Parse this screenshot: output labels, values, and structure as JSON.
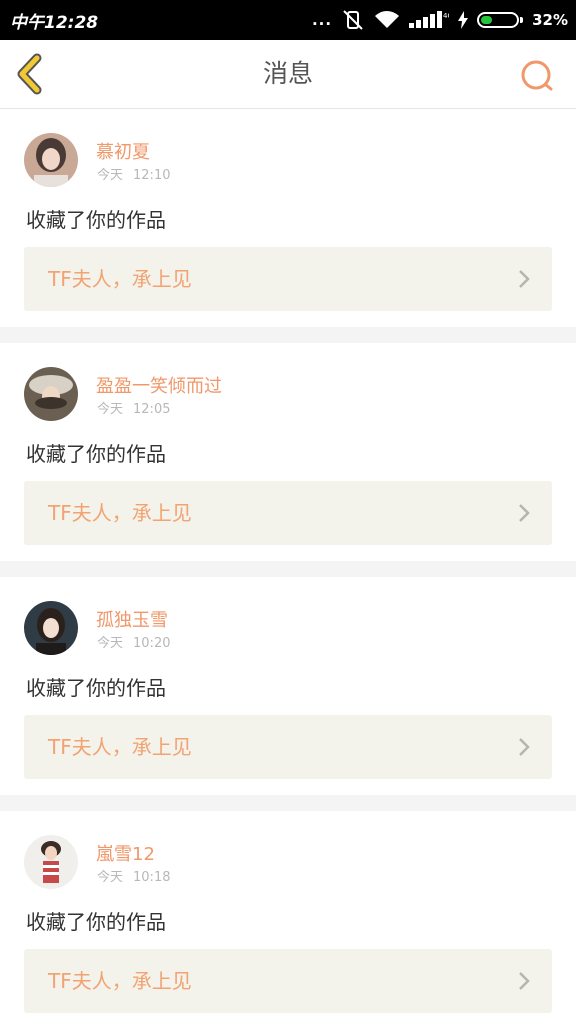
{
  "status_bar": {
    "time": "中午12:28",
    "dots": "...",
    "battery_percent": "32%",
    "battery_level": 0.32
  },
  "header": {
    "title": "消息",
    "back_icon": "chevron-left-icon",
    "search_icon": "search-icon"
  },
  "colors": {
    "accent": "#f0986a",
    "back_arrow": "#f2c933",
    "work_box_bg": "#f3f3ec"
  },
  "notifications": [
    {
      "username": "慕初夏",
      "day": "今天",
      "time": "12:10",
      "action": "收藏了你的作品",
      "work_title": "TF夫人，承上见"
    },
    {
      "username": "盈盈一笑倾而过",
      "day": "今天",
      "time": "12:05",
      "action": "收藏了你的作品",
      "work_title": "TF夫人，承上见"
    },
    {
      "username": "孤独玉雪",
      "day": "今天",
      "time": "10:20",
      "action": "收藏了你的作品",
      "work_title": "TF夫人，承上见"
    },
    {
      "username": "嵐雪12",
      "day": "今天",
      "time": "10:18",
      "action": "收藏了你的作品",
      "work_title": "TF夫人，承上见"
    }
  ]
}
